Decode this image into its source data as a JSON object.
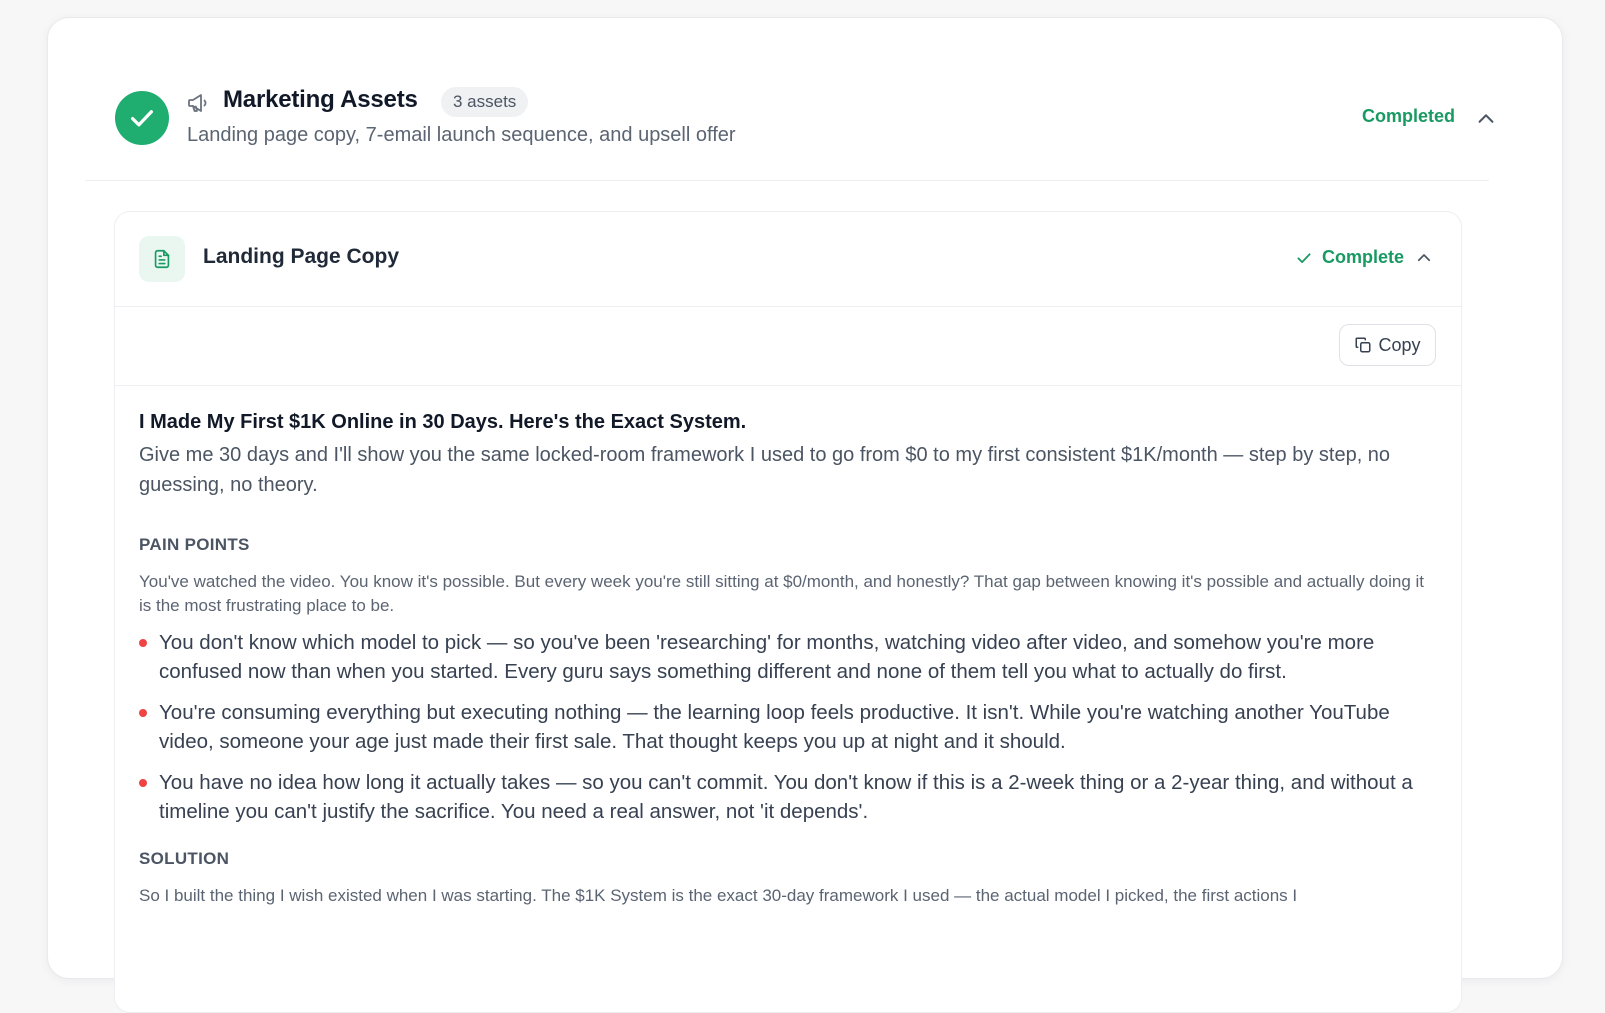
{
  "section": {
    "title": "Marketing Assets",
    "badge": "3 assets",
    "subtitle": "Landing page copy, 7-email launch sequence, and upsell offer",
    "status": "Completed"
  },
  "asset": {
    "title": "Landing Page Copy",
    "status": "Complete",
    "copy_label": "Copy"
  },
  "content": {
    "headline": "I Made My First $1K Online in 30 Days. Here's the Exact System.",
    "subhead": "Give me 30 days and I'll show you the same locked-room framework I used to go from $0 to my first consistent $1K/month — step by step, no guessing, no theory.",
    "pain_points": {
      "label": "PAIN POINTS",
      "intro": "You've watched the video. You know it's possible. But every week you're still sitting at $0/month, and honestly? That gap between knowing it's possible and actually doing it is the most frustrating place to be.",
      "items": [
        "You don't know which model to pick — so you've been 'researching' for months, watching video after video, and somehow you're more confused now than when you started. Every guru says something different and none of them tell you what to actually do first.",
        "You're consuming everything but executing nothing — the learning loop feels productive. It isn't. While you're watching another YouTube video, someone your age just made their first sale. That thought keeps you up at night and it should.",
        "You have no idea how long it actually takes — so you can't commit. You don't know if this is a 2-week thing or a 2-year thing, and without a timeline you can't justify the sacrifice. You need a real answer, not 'it depends'."
      ]
    },
    "solution": {
      "label": "SOLUTION",
      "intro": "So I built the thing I wish existed when I was starting. The $1K System is the exact 30-day framework I used — the actual model I picked, the first actions I"
    }
  },
  "colors": {
    "accent_green": "#1fae70",
    "status_green": "#1a9a63",
    "bullet_red": "#ef4444"
  }
}
